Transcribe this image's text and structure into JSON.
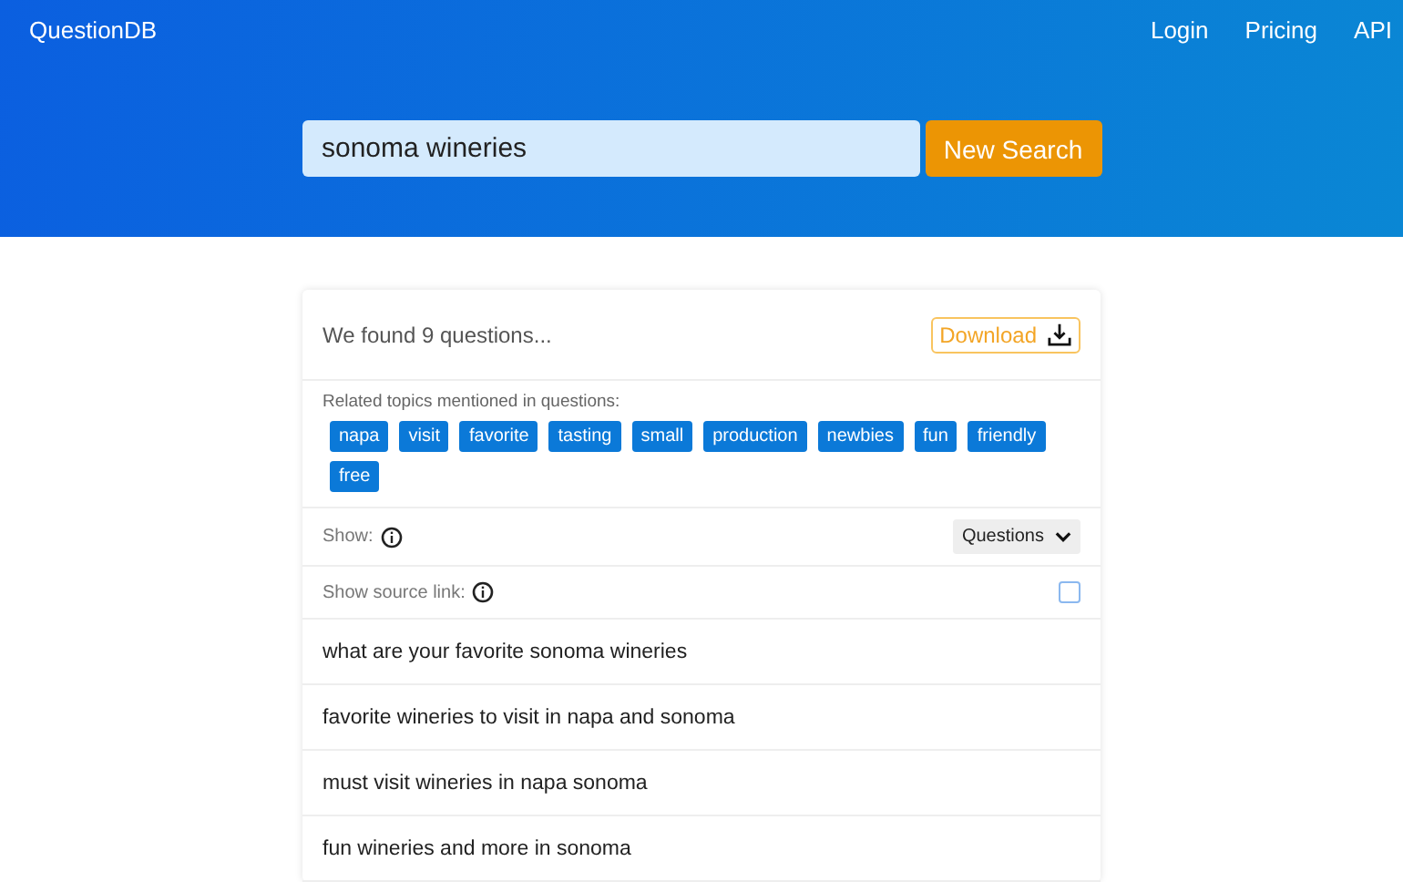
{
  "brand": "QuestionDB",
  "nav": [
    "Login",
    "Pricing",
    "API"
  ],
  "search": {
    "value": "sonoma wineries",
    "button": "New Search"
  },
  "results": {
    "summary": "We found 9 questions...",
    "download": "Download",
    "topics_label": "Related topics mentioned in questions:",
    "topics": [
      "napa",
      "visit",
      "favorite",
      "tasting",
      "small",
      "production",
      "newbies",
      "fun",
      "friendly",
      "free"
    ],
    "show_label": "Show:",
    "show_select": "Questions",
    "source_label": "Show source link:",
    "source_checked": false,
    "questions": [
      "what are your favorite sonoma wineries",
      "favorite wineries to visit in napa and sonoma",
      "must visit wineries in napa sonoma",
      "fun wineries and more in sonoma"
    ]
  }
}
